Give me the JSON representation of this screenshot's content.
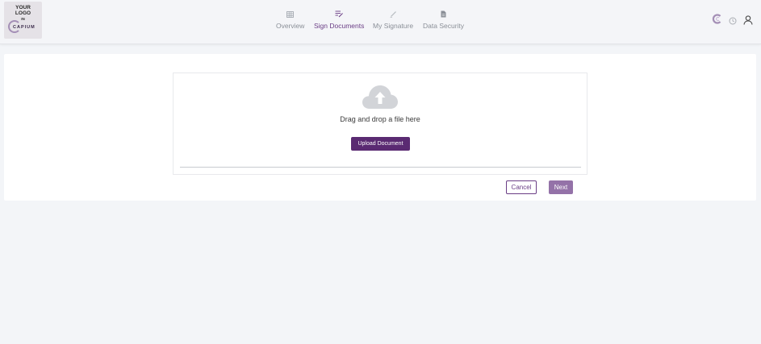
{
  "logo": {
    "line1": "YOUR",
    "line2": "LOGO",
    "line3": "IN",
    "brand": "CAPIUM"
  },
  "nav": {
    "items": [
      {
        "label": "Overview",
        "icon": "grid-icon",
        "active": false
      },
      {
        "label": "Sign Documents",
        "icon": "sign-document-icon",
        "active": true
      },
      {
        "label": "My Signature",
        "icon": "pen-icon",
        "active": false
      },
      {
        "label": "Data Security",
        "icon": "document-icon",
        "active": false
      }
    ]
  },
  "top_icons": [
    "capium-logo-icon",
    "clock-icon",
    "user-icon"
  ],
  "upload": {
    "drop_text": "Drag and drop a file here",
    "upload_button": "Upload Document",
    "icon": "cloud-upload-icon"
  },
  "actions": {
    "cancel": "Cancel",
    "next": "Next"
  },
  "colors": {
    "primary": "#5a2a72",
    "accent": "#6a3d85",
    "next_button": "#9472a8"
  }
}
